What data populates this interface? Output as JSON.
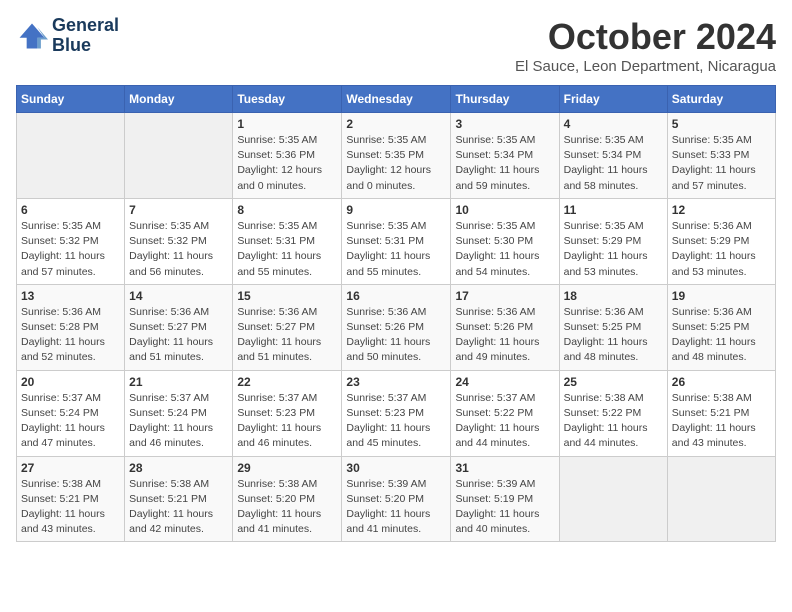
{
  "header": {
    "logo_line1": "General",
    "logo_line2": "Blue",
    "title": "October 2024",
    "subtitle": "El Sauce, Leon Department, Nicaragua"
  },
  "days_of_week": [
    "Sunday",
    "Monday",
    "Tuesday",
    "Wednesday",
    "Thursday",
    "Friday",
    "Saturday"
  ],
  "weeks": [
    [
      {
        "day": "",
        "info": ""
      },
      {
        "day": "",
        "info": ""
      },
      {
        "day": "1",
        "info": "Sunrise: 5:35 AM\nSunset: 5:36 PM\nDaylight: 12 hours\nand 0 minutes."
      },
      {
        "day": "2",
        "info": "Sunrise: 5:35 AM\nSunset: 5:35 PM\nDaylight: 12 hours\nand 0 minutes."
      },
      {
        "day": "3",
        "info": "Sunrise: 5:35 AM\nSunset: 5:34 PM\nDaylight: 11 hours\nand 59 minutes."
      },
      {
        "day": "4",
        "info": "Sunrise: 5:35 AM\nSunset: 5:34 PM\nDaylight: 11 hours\nand 58 minutes."
      },
      {
        "day": "5",
        "info": "Sunrise: 5:35 AM\nSunset: 5:33 PM\nDaylight: 11 hours\nand 57 minutes."
      }
    ],
    [
      {
        "day": "6",
        "info": "Sunrise: 5:35 AM\nSunset: 5:32 PM\nDaylight: 11 hours\nand 57 minutes."
      },
      {
        "day": "7",
        "info": "Sunrise: 5:35 AM\nSunset: 5:32 PM\nDaylight: 11 hours\nand 56 minutes."
      },
      {
        "day": "8",
        "info": "Sunrise: 5:35 AM\nSunset: 5:31 PM\nDaylight: 11 hours\nand 55 minutes."
      },
      {
        "day": "9",
        "info": "Sunrise: 5:35 AM\nSunset: 5:31 PM\nDaylight: 11 hours\nand 55 minutes."
      },
      {
        "day": "10",
        "info": "Sunrise: 5:35 AM\nSunset: 5:30 PM\nDaylight: 11 hours\nand 54 minutes."
      },
      {
        "day": "11",
        "info": "Sunrise: 5:35 AM\nSunset: 5:29 PM\nDaylight: 11 hours\nand 53 minutes."
      },
      {
        "day": "12",
        "info": "Sunrise: 5:36 AM\nSunset: 5:29 PM\nDaylight: 11 hours\nand 53 minutes."
      }
    ],
    [
      {
        "day": "13",
        "info": "Sunrise: 5:36 AM\nSunset: 5:28 PM\nDaylight: 11 hours\nand 52 minutes."
      },
      {
        "day": "14",
        "info": "Sunrise: 5:36 AM\nSunset: 5:27 PM\nDaylight: 11 hours\nand 51 minutes."
      },
      {
        "day": "15",
        "info": "Sunrise: 5:36 AM\nSunset: 5:27 PM\nDaylight: 11 hours\nand 51 minutes."
      },
      {
        "day": "16",
        "info": "Sunrise: 5:36 AM\nSunset: 5:26 PM\nDaylight: 11 hours\nand 50 minutes."
      },
      {
        "day": "17",
        "info": "Sunrise: 5:36 AM\nSunset: 5:26 PM\nDaylight: 11 hours\nand 49 minutes."
      },
      {
        "day": "18",
        "info": "Sunrise: 5:36 AM\nSunset: 5:25 PM\nDaylight: 11 hours\nand 48 minutes."
      },
      {
        "day": "19",
        "info": "Sunrise: 5:36 AM\nSunset: 5:25 PM\nDaylight: 11 hours\nand 48 minutes."
      }
    ],
    [
      {
        "day": "20",
        "info": "Sunrise: 5:37 AM\nSunset: 5:24 PM\nDaylight: 11 hours\nand 47 minutes."
      },
      {
        "day": "21",
        "info": "Sunrise: 5:37 AM\nSunset: 5:24 PM\nDaylight: 11 hours\nand 46 minutes."
      },
      {
        "day": "22",
        "info": "Sunrise: 5:37 AM\nSunset: 5:23 PM\nDaylight: 11 hours\nand 46 minutes."
      },
      {
        "day": "23",
        "info": "Sunrise: 5:37 AM\nSunset: 5:23 PM\nDaylight: 11 hours\nand 45 minutes."
      },
      {
        "day": "24",
        "info": "Sunrise: 5:37 AM\nSunset: 5:22 PM\nDaylight: 11 hours\nand 44 minutes."
      },
      {
        "day": "25",
        "info": "Sunrise: 5:38 AM\nSunset: 5:22 PM\nDaylight: 11 hours\nand 44 minutes."
      },
      {
        "day": "26",
        "info": "Sunrise: 5:38 AM\nSunset: 5:21 PM\nDaylight: 11 hours\nand 43 minutes."
      }
    ],
    [
      {
        "day": "27",
        "info": "Sunrise: 5:38 AM\nSunset: 5:21 PM\nDaylight: 11 hours\nand 43 minutes."
      },
      {
        "day": "28",
        "info": "Sunrise: 5:38 AM\nSunset: 5:21 PM\nDaylight: 11 hours\nand 42 minutes."
      },
      {
        "day": "29",
        "info": "Sunrise: 5:38 AM\nSunset: 5:20 PM\nDaylight: 11 hours\nand 41 minutes."
      },
      {
        "day": "30",
        "info": "Sunrise: 5:39 AM\nSunset: 5:20 PM\nDaylight: 11 hours\nand 41 minutes."
      },
      {
        "day": "31",
        "info": "Sunrise: 5:39 AM\nSunset: 5:19 PM\nDaylight: 11 hours\nand 40 minutes."
      },
      {
        "day": "",
        "info": ""
      },
      {
        "day": "",
        "info": ""
      }
    ]
  ]
}
